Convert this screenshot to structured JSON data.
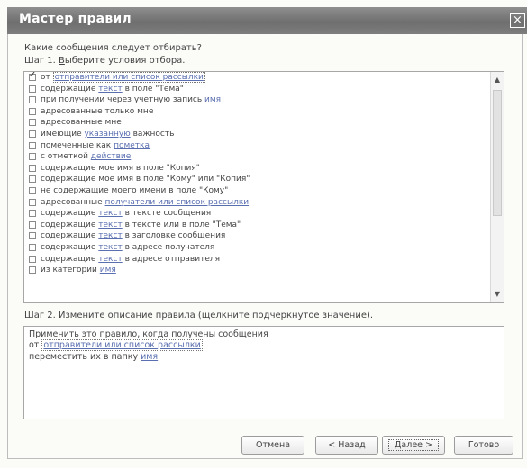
{
  "window": {
    "title": "Мастер правил",
    "close_glyph": "×"
  },
  "header": {
    "question": "Какие сообщения следует отбирать?",
    "step1_prefix": "Шаг 1. ",
    "step1_underlined": "В",
    "step1_rest": "ыберите условия отбора."
  },
  "conditions": [
    {
      "checked": true,
      "pre": "от ",
      "link": "отправители или список рассылки",
      "post": ""
    },
    {
      "checked": false,
      "pre": "содержащие ",
      "link": "текст",
      "post": " в поле \"Тема\""
    },
    {
      "checked": false,
      "pre": "при получении через учетную запись ",
      "link": "имя",
      "post": ""
    },
    {
      "checked": false,
      "pre": "адресованные только мне",
      "link": "",
      "post": ""
    },
    {
      "checked": false,
      "pre": "адресованные мне",
      "link": "",
      "post": ""
    },
    {
      "checked": false,
      "pre": "имеющие ",
      "link": "указанную",
      "post": " важность"
    },
    {
      "checked": false,
      "pre": "помеченные как ",
      "link": "пометка",
      "post": ""
    },
    {
      "checked": false,
      "pre": "с отметкой ",
      "link": "действие",
      "post": ""
    },
    {
      "checked": false,
      "pre": "содержащие мое имя в поле \"Копия\"",
      "link": "",
      "post": ""
    },
    {
      "checked": false,
      "pre": "содержащие мое имя в поле \"Кому\" или \"Копия\"",
      "link": "",
      "post": ""
    },
    {
      "checked": false,
      "pre": "не содержащие моего имени в поле \"Кому\"",
      "link": "",
      "post": ""
    },
    {
      "checked": false,
      "pre": "адресованные ",
      "link": "получатели или список рассылки",
      "post": ""
    },
    {
      "checked": false,
      "pre": "содержащие ",
      "link": "текст",
      "post": " в тексте сообщения"
    },
    {
      "checked": false,
      "pre": "содержащие ",
      "link": "текст",
      "post": " в тексте или в поле \"Тема\""
    },
    {
      "checked": false,
      "pre": "содержащие ",
      "link": "текст",
      "post": " в заголовке сообщения"
    },
    {
      "checked": false,
      "pre": "содержащие ",
      "link": "текст",
      "post": " в адресе получателя"
    },
    {
      "checked": false,
      "pre": "содержащие ",
      "link": "текст",
      "post": " в адресе отправителя"
    },
    {
      "checked": false,
      "pre": "из категории ",
      "link": "имя",
      "post": ""
    }
  ],
  "step2": {
    "label": "Шаг 2. Измените описание правила (щелкните подчеркнутое значение).",
    "line1": "Применить это правило, когда получены сообщения",
    "line2_pre": "от ",
    "line2_link": "отправители или список рассылки",
    "line3_pre": "переместить их в папку ",
    "line3_link": "имя"
  },
  "buttons": {
    "cancel": "Отмена",
    "back": "< Назад",
    "next": "Далее >",
    "finish": "Готово"
  },
  "scroll": {
    "up_glyph": "▲",
    "down_glyph": "▼"
  }
}
